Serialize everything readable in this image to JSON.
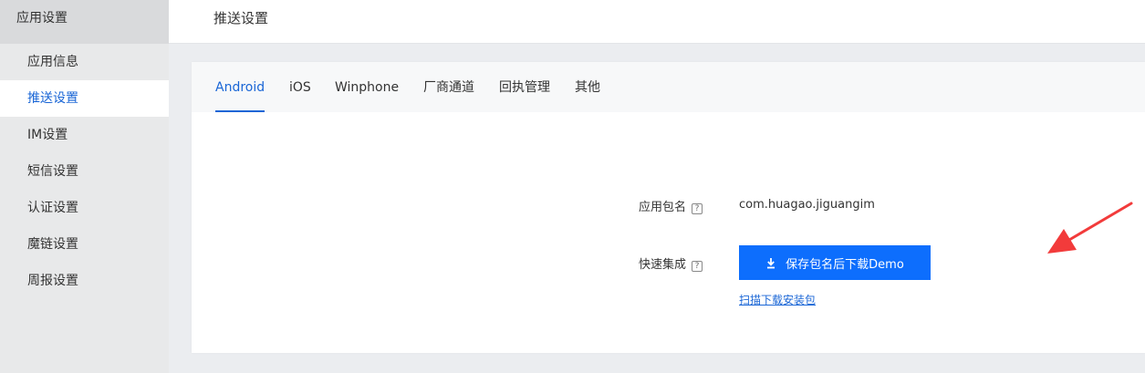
{
  "sidebar": {
    "title": "应用设置",
    "items": [
      {
        "label": "应用信息",
        "active": false
      },
      {
        "label": "推送设置",
        "active": true
      },
      {
        "label": "IM设置",
        "active": false
      },
      {
        "label": "短信设置",
        "active": false
      },
      {
        "label": "认证设置",
        "active": false
      },
      {
        "label": "魔链设置",
        "active": false
      },
      {
        "label": "周报设置",
        "active": false
      }
    ]
  },
  "header": {
    "title": "推送设置"
  },
  "tabs": [
    {
      "label": "Android",
      "active": true
    },
    {
      "label": "iOS"
    },
    {
      "label": "Winphone"
    },
    {
      "label": "厂商通道"
    },
    {
      "label": "回执管理"
    },
    {
      "label": "其他"
    }
  ],
  "form": {
    "package": {
      "label": "应用包名",
      "value": "com.huagao.jiguangim"
    },
    "quick": {
      "label": "快速集成",
      "button_label": "保存包名后下载Demo",
      "link_label": "扫描下载安装包"
    },
    "help_glyph": "?"
  },
  "icons": {
    "help": "question-square-icon",
    "download": "download-icon",
    "annotation": "red-arrow-icon"
  },
  "colors": {
    "accent": "#1a66d6",
    "button": "#0d6efd",
    "annotation": "#f23b3b"
  }
}
